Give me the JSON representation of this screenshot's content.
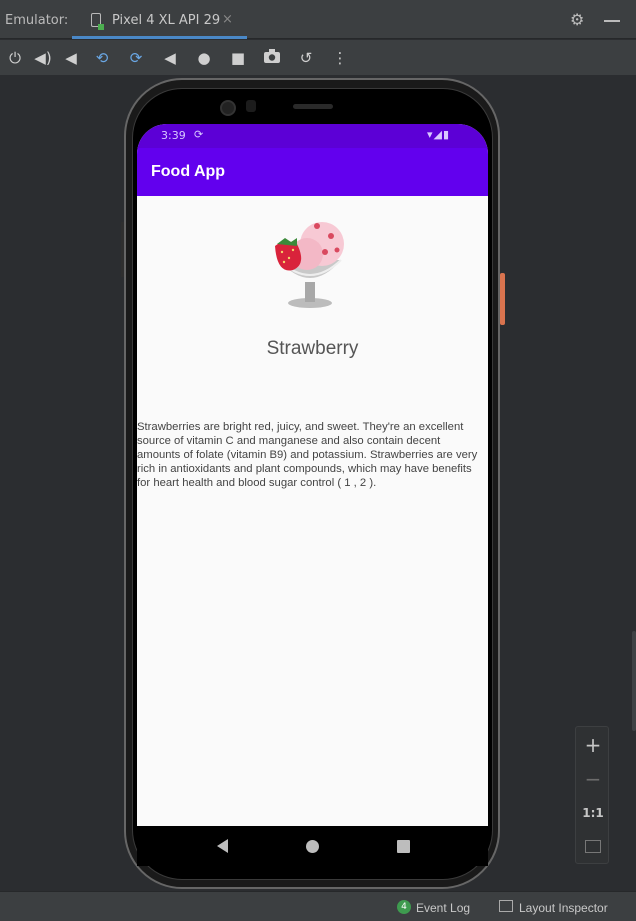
{
  "ide": {
    "emulator_label": "Emulator:",
    "tab_title": "Pixel 4 XL API 29",
    "tab_close": "×",
    "accent_color": "#4a88c7"
  },
  "toolbar": {
    "items": [
      {
        "icon": "power-icon",
        "glyph": "⏻"
      },
      {
        "icon": "volume-up-icon",
        "glyph": "🔊"
      },
      {
        "icon": "volume-down-icon",
        "glyph": "🔉"
      },
      {
        "icon": "rotate-left-icon",
        "glyph": "⟲"
      },
      {
        "icon": "rotate-right-icon",
        "glyph": "⟳"
      },
      {
        "icon": "back-icon",
        "glyph": "◀"
      },
      {
        "icon": "home-icon",
        "glyph": "●"
      },
      {
        "icon": "overview-icon",
        "glyph": "■"
      },
      {
        "icon": "camera-icon",
        "glyph": "📷"
      },
      {
        "icon": "snapshot-icon",
        "glyph": "↺"
      },
      {
        "icon": "more-icon",
        "glyph": "⋮"
      }
    ]
  },
  "device": {
    "status_time": "3:39",
    "status_sync": "⟳",
    "status_icons": "▾◢▮",
    "app_title": "Food App",
    "app_bar_color": "#6200ee",
    "status_bar_color": "#5c00d6",
    "food": {
      "name": "Strawberry",
      "image": "strawberry-ice-cream-icon",
      "description": "Strawberries are bright red, juicy, and sweet. They're an excellent source of vitamin C and manganese and also contain decent amounts of folate (vitamin B9) and potassium. Strawberries are very rich in antioxidants and plant compounds, which may have benefits for heart health and blood sugar control ( 1 , 2 )."
    }
  },
  "zoom": {
    "plus": "+",
    "minus": "−",
    "ratio": "1:1"
  },
  "statusbar": {
    "event_log_count": "4",
    "event_log_label": "Event Log",
    "layout_inspector_label": "Layout Inspector"
  }
}
